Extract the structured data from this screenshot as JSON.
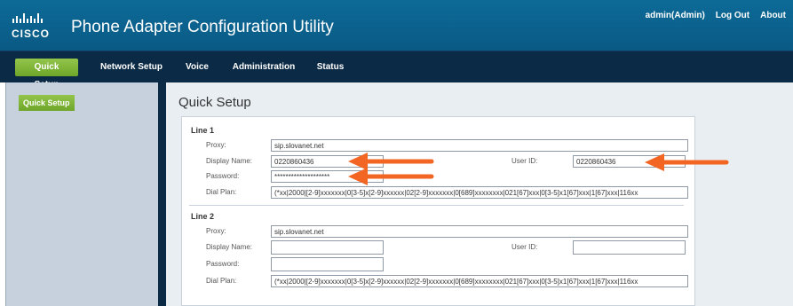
{
  "header": {
    "logo_text": "CISCO",
    "title": "Phone Adapter Configuration Utility",
    "links": [
      "admin(Admin)",
      "Log Out",
      "About"
    ]
  },
  "nav": {
    "items": [
      "Quick Setup",
      "Network Setup",
      "Voice",
      "Administration",
      "Status"
    ],
    "active": "Quick Setup"
  },
  "sidebar": {
    "items": [
      "Quick Setup"
    ]
  },
  "page": {
    "title": "Quick Setup"
  },
  "line1": {
    "title": "Line 1",
    "proxy_label": "Proxy:",
    "proxy_value": "sip.slovanet.net",
    "display_name_label": "Display Name:",
    "display_name_value": "0220860436",
    "user_id_label": "User ID:",
    "user_id_value": "0220860436",
    "password_label": "Password:",
    "password_value": "********************",
    "dial_plan_label": "Dial Plan:",
    "dial_plan_value": "(*xx|2000|[2-9]xxxxxxx|0[3-5]x[2-9]xxxxxx|02[2-9]xxxxxxx|0[689]xxxxxxxx|021[67]xxx|0[3-5]x1[67]xxx|1[67]xxx|116xx"
  },
  "line2": {
    "title": "Line 2",
    "proxy_label": "Proxy:",
    "proxy_value": "sip.slovanet.net",
    "display_name_label": "Display Name:",
    "display_name_value": "",
    "user_id_label": "User ID:",
    "user_id_value": "",
    "password_label": "Password:",
    "password_value": "",
    "dial_plan_label": "Dial Plan:",
    "dial_plan_value": "(*xx|2000|[2-9]xxxxxxx|0[3-5]x[2-9]xxxxxx|02[2-9]xxxxxxx|0[689]xxxxxxxx|021[67]xxx|0[3-5]x1[67]xxx|1[67]xxx|116xx"
  },
  "colors": {
    "header_blue": "#0a5a85",
    "nav_navy": "#0b2a45",
    "active_green": "#7fb63a",
    "annotation_arrow": "#f26522"
  }
}
